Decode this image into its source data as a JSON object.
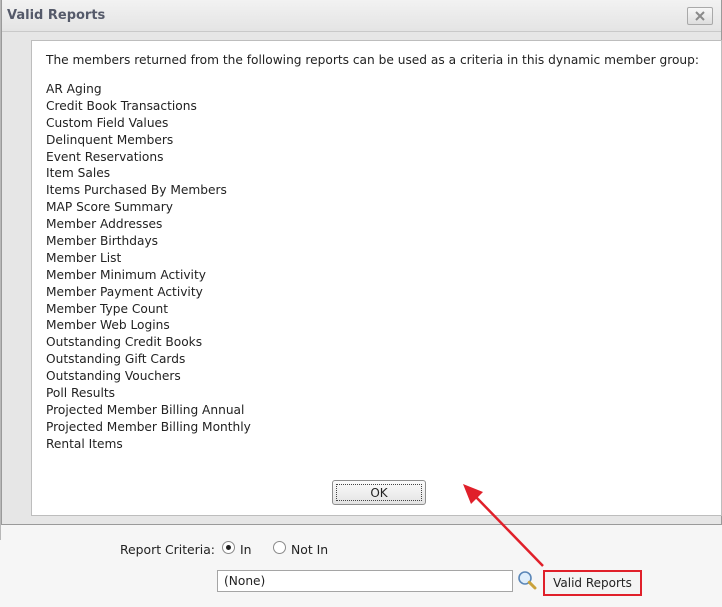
{
  "dialog": {
    "title": "Valid Reports",
    "close_icon": "close-icon",
    "intro_text": "The members returned from the following reports can be used as a criteria in this dynamic member group:",
    "reports": [
      "AR Aging",
      "Credit Book Transactions",
      "Custom Field Values",
      "Delinquent Members",
      "Event Reservations",
      "Item Sales",
      "Items Purchased By Members",
      "MAP Score Summary",
      "Member Addresses",
      "Member Birthdays",
      "Member List",
      "Member Minimum Activity",
      "Member Payment Activity",
      "Member Type Count",
      "Member Web Logins",
      "Outstanding Credit Books",
      "Outstanding Gift Cards",
      "Outstanding Vouchers",
      "Poll Results",
      "Projected Member Billing Annual",
      "Projected Member Billing Monthly",
      "Rental Items"
    ],
    "ok_label": "OK"
  },
  "criteria": {
    "label": "Report Criteria:",
    "options": [
      {
        "label": "In",
        "selected": true
      },
      {
        "label": "Not In",
        "selected": false
      }
    ],
    "report_value": "(None)",
    "search_icon": "search-icon",
    "valid_reports_label": "Valid Reports"
  },
  "colors": {
    "highlight_border": "#e0202a",
    "annotation_arrow": "#e0202a",
    "title_text": "#555a6a"
  }
}
